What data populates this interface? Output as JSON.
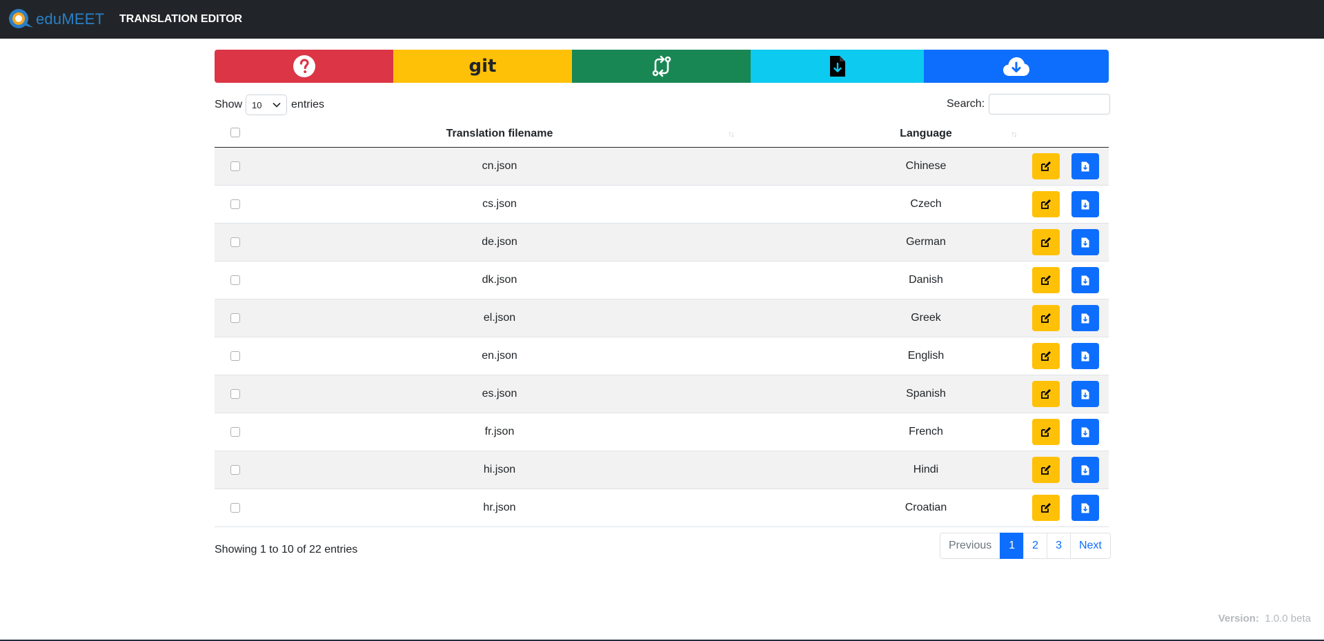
{
  "app": {
    "logo_edu": "edu",
    "logo_meet": "MEET",
    "title": "TRANSLATION EDITOR"
  },
  "toolbar": {
    "buttons": [
      {
        "name": "help",
        "icon": "question-circle-icon",
        "color": "#dc3545"
      },
      {
        "name": "git",
        "label": "git",
        "color": "#ffc107"
      },
      {
        "name": "pull-request",
        "icon": "git-compare-icon",
        "color": "#198754"
      },
      {
        "name": "download-file",
        "icon": "file-download-icon",
        "color": "#0dcaf0"
      },
      {
        "name": "cloud-download",
        "icon": "cloud-download-icon",
        "color": "#0d6efd"
      }
    ]
  },
  "length": {
    "show_label": "Show",
    "value": "10",
    "entries_label": "entries"
  },
  "search": {
    "label": "Search:",
    "value": ""
  },
  "table": {
    "headers": {
      "filename": "Translation filename",
      "language": "Language"
    },
    "rows": [
      {
        "file": "cn.json",
        "language": "Chinese"
      },
      {
        "file": "cs.json",
        "language": "Czech"
      },
      {
        "file": "de.json",
        "language": "German"
      },
      {
        "file": "dk.json",
        "language": "Danish"
      },
      {
        "file": "el.json",
        "language": "Greek"
      },
      {
        "file": "en.json",
        "language": "English"
      },
      {
        "file": "es.json",
        "language": "Spanish"
      },
      {
        "file": "fr.json",
        "language": "French"
      },
      {
        "file": "hi.json",
        "language": "Hindi"
      },
      {
        "file": "hr.json",
        "language": "Croatian"
      }
    ]
  },
  "info": "Showing 1 to 10 of 22 entries",
  "pagination": {
    "previous": "Previous",
    "pages": [
      "1",
      "2",
      "3"
    ],
    "active": "1",
    "next": "Next"
  },
  "version": {
    "label": "Version:",
    "value": "1.0.0 beta"
  },
  "colors": {
    "navbar": "#212529",
    "danger": "#dc3545",
    "warning": "#ffc107",
    "success": "#198754",
    "info": "#0dcaf0",
    "primary": "#0d6efd"
  }
}
